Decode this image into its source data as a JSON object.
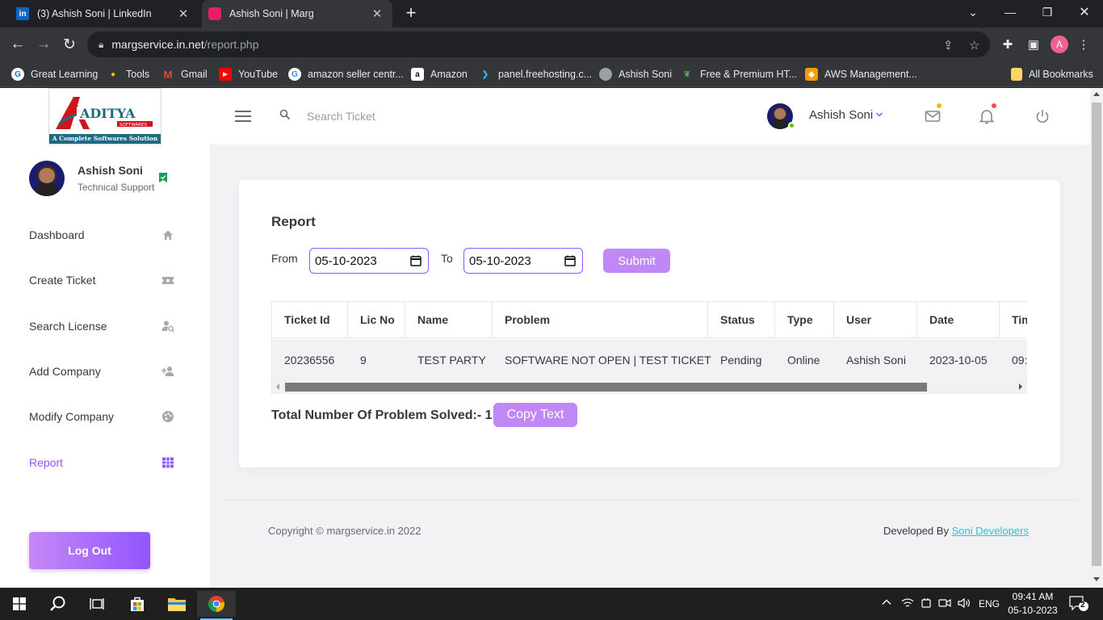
{
  "browser": {
    "tabs": [
      {
        "title": "(3) Ashish Soni | LinkedIn",
        "icon": "linkedin-icon"
      },
      {
        "title": "Ashish Soni | Marg",
        "icon": "marg-icon"
      }
    ],
    "url_host": "margservice.in.net",
    "url_path": "/report.php",
    "profile_initial": "A",
    "bookmarks": [
      "Great Learning",
      "Tools",
      "Gmail",
      "YouTube",
      "amazon seller centr...",
      "Amazon",
      "panel.freehosting.c...",
      "Ashish Soni",
      "Free & Premium HT...",
      "AWS Management..."
    ],
    "all_bookmarks": "All Bookmarks"
  },
  "logo": {
    "brand": "ADITYA",
    "sub": "SOFTWARES",
    "tagline": "A Complete Softwares Solution"
  },
  "user": {
    "name": "Ashish Soni",
    "role": "Technical Support"
  },
  "nav": [
    {
      "label": "Dashboard",
      "icon": "home-icon"
    },
    {
      "label": "Create Ticket",
      "icon": "ticket-icon"
    },
    {
      "label": "Search License",
      "icon": "user-search-icon"
    },
    {
      "label": "Add Company",
      "icon": "user-plus-icon"
    },
    {
      "label": "Modify Company",
      "icon": "palette-icon"
    },
    {
      "label": "Report",
      "icon": "grid-icon",
      "active": true
    }
  ],
  "logout_label": "Log Out",
  "topbar": {
    "search_placeholder": "Search Ticket",
    "user_name": "Ashish Soni"
  },
  "report": {
    "title": "Report",
    "from_label": "From",
    "to_label": "To",
    "from_date": "05-10-2023",
    "to_date": "05-10-2023",
    "submit_label": "Submit",
    "columns": [
      "Ticket Id",
      "Lic No",
      "Name",
      "Problem",
      "Status",
      "Type",
      "User",
      "Date",
      "Tim"
    ],
    "rows": [
      [
        "20236556",
        "9",
        "TEST PARTY",
        "SOFTWARE NOT OPEN | TEST TICKET",
        "Pending",
        "Online",
        "Ashish Soni",
        "2023-10-05",
        "09:"
      ]
    ],
    "total_text": "Total Number Of Problem Solved:- 1",
    "copy_label": "Copy Text"
  },
  "footer": {
    "copyright": "Copyright © margservice.in 2022",
    "developed_by": "Developed By",
    "developer": "Soni Developers"
  },
  "taskbar": {
    "time": "09:41 AM",
    "date": "05-10-2023",
    "lang": "ENG",
    "notifications": "2"
  },
  "colors": {
    "accent": "#9155fd",
    "button": "#c088f5",
    "link": "#26c6da"
  }
}
